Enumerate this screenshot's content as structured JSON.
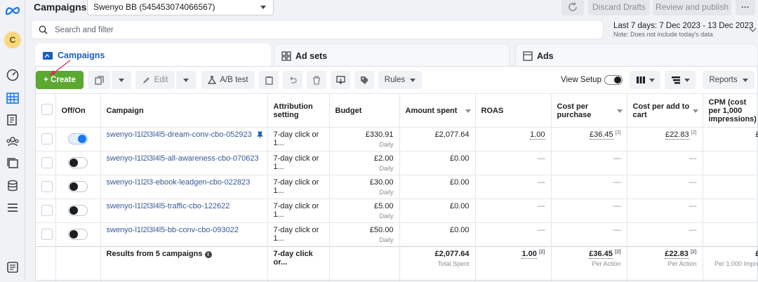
{
  "app": {
    "title": "Campaigns",
    "account": "Swenyo BB (545453074066567)",
    "discard": "Discard Drafts",
    "review": "Review and publish",
    "more": "···",
    "avatar": "C"
  },
  "search": {
    "placeholder": "Search and filter"
  },
  "daterange": {
    "label": "Last 7 days: 7 Dec 2023 - 13 Dec 2023",
    "note": "Note: Does not include today's data"
  },
  "tabs": [
    {
      "label": "Campaigns"
    },
    {
      "label": "Ad sets"
    },
    {
      "label": "Ads"
    }
  ],
  "toolbar": {
    "create": "+ Create",
    "edit": "Edit",
    "ab_test": "A/B test",
    "rules": "Rules",
    "view_setup": "View Setup",
    "reports": "Reports"
  },
  "table": {
    "headers": [
      "Off/On",
      "Campaign",
      "Attribution setting",
      "Budget",
      "Amount spent",
      "ROAS",
      "Cost per purchase",
      "Cost per add to cart",
      "CPM (cost per 1,000 impressions)"
    ],
    "rows": [
      {
        "on": true,
        "name": "swenyo-l1l2l3l4l5-dream-conv-cbo-052923",
        "attr": "7-day click or 1...",
        "budget": "£330.91",
        "budget_sub": "Daily",
        "spent": "£2,077.64",
        "roas": "1.00",
        "cpp": "£36.45",
        "cpp_sup": "[2]",
        "cpa": "£22.83",
        "cpa_sup": "[2]",
        "cpm": "£"
      },
      {
        "on": false,
        "name": "swenyo-l1l2l3l4l5-all-awareness-cbo-070623",
        "attr": "7-day click or 1...",
        "budget": "£2.00",
        "budget_sub": "Daily",
        "spent": "£0.00",
        "roas": "—",
        "cpp": "—",
        "cpp_sup": "",
        "cpa": "—",
        "cpa_sup": "",
        "cpm": ""
      },
      {
        "on": false,
        "name": "swenyo-l1l2l3-ebook-leadgen-cbo-022823",
        "attr": "7-day click or 1...",
        "budget": "£30.00",
        "budget_sub": "Daily",
        "spent": "£0.00",
        "roas": "—",
        "cpp": "—",
        "cpp_sup": "",
        "cpa": "—",
        "cpa_sup": "",
        "cpm": ""
      },
      {
        "on": false,
        "name": "swenyo-l1l2l3l4l5-traffic-cbo-122622",
        "attr": "7-day click or 1...",
        "budget": "£5.00",
        "budget_sub": "Daily",
        "spent": "£0.00",
        "roas": "—",
        "cpp": "—",
        "cpp_sup": "",
        "cpa": "—",
        "cpa_sup": "",
        "cpm": ""
      },
      {
        "on": false,
        "name": "swenyo-l1l2l3l4l5-bb-conv-cbo-093022",
        "attr": "7-day click or 1...",
        "budget": "£50.00",
        "budget_sub": "Daily",
        "spent": "£0.00",
        "roas": "—",
        "cpp": "—",
        "cpp_sup": "",
        "cpa": "—",
        "cpa_sup": "",
        "cpm": ""
      }
    ],
    "summary": {
      "label": "Results from 5 campaigns",
      "attr": "7-day click or...",
      "spent": "£2,077.64",
      "spent_sub": "Total Spent",
      "roas": "1.00",
      "roas_sup": "[2]",
      "cpp": "£36.45",
      "cpp_sup": "[2]",
      "cpp_sub": "Per Action",
      "cpa": "£22.83",
      "cpa_sup": "[2]",
      "cpa_sub": "Per Action",
      "cpm": "£",
      "cpm_sub": "Per 1,000 Impre"
    }
  },
  "colors": {
    "create": "#5ba833",
    "accent": "#1877f2",
    "link": "#385898"
  }
}
